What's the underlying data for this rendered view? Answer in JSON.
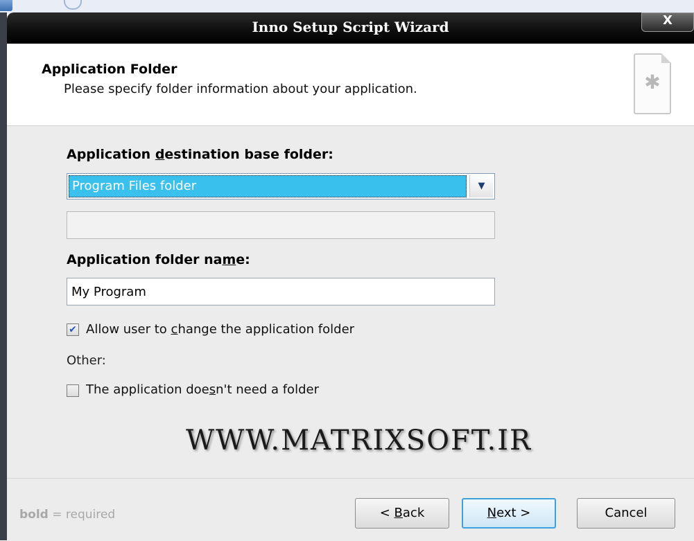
{
  "window": {
    "title": "Inno Setup Script Wizard",
    "close_label": "X"
  },
  "header": {
    "title": "Application Folder",
    "subtitle": "Please specify folder information about your application.",
    "icon": "wizard-page-icon"
  },
  "form": {
    "dest_label_pre": "Application ",
    "dest_label_u": "d",
    "dest_label_post": "estination base folder:",
    "dest_value": "Program Files folder",
    "name_label_pre": "Application folder na",
    "name_label_u": "m",
    "name_label_post": "e:",
    "name_value": "My Program",
    "allow_change_pre": "Allow user to ",
    "allow_change_u": "c",
    "allow_change_post": "hange the application folder",
    "allow_change_checked": true,
    "other_label": "Other:",
    "no_folder_pre": "The application doe",
    "no_folder_u": "s",
    "no_folder_post": "n't need a folder",
    "no_folder_checked": false
  },
  "watermark": "WWW.MATRIXSOFT.IR",
  "footer": {
    "legend_bold": "bold",
    "legend_rest": " = required",
    "back_pre": "< ",
    "back_u": "B",
    "back_post": "ack",
    "next_u": "N",
    "next_post": "ext >",
    "cancel_label": "Cancel"
  }
}
